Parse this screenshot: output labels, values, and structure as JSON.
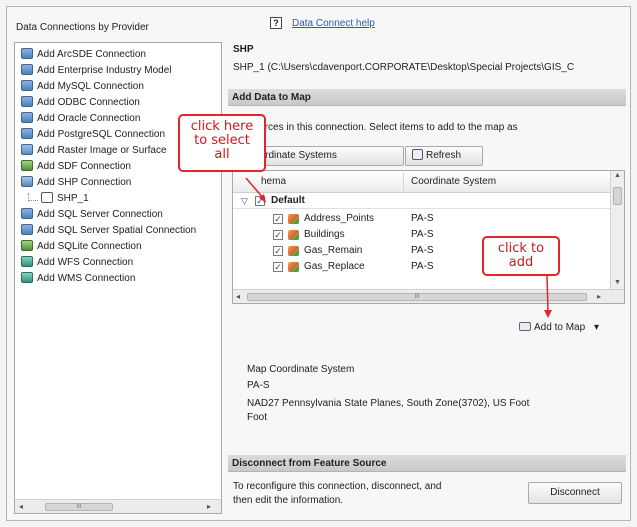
{
  "left_panel": {
    "title": "Data Connections by Provider",
    "items": [
      {
        "label": "Add ArcSDE Connection",
        "icon": "database-icon"
      },
      {
        "label": "Add Enterprise Industry Model",
        "icon": "database-icon"
      },
      {
        "label": "Add MySQL Connection",
        "icon": "database-icon"
      },
      {
        "label": "Add ODBC Connection",
        "icon": "database-icon"
      },
      {
        "label": "Add Oracle Connection",
        "icon": "database-icon"
      },
      {
        "label": "Add PostgreSQL Connection",
        "icon": "database-icon"
      },
      {
        "label": "Add Raster Image or Surface",
        "icon": "raster-icon"
      },
      {
        "label": "Add SDF Connection",
        "icon": "sdf-icon"
      },
      {
        "label": "Add SHP Connection",
        "icon": "shp-icon"
      },
      {
        "label": "SHP_1",
        "icon": "connection-child-icon"
      },
      {
        "label": "Add SQL Server Connection",
        "icon": "database-icon"
      },
      {
        "label": "Add SQL Server Spatial Connection",
        "icon": "database-icon"
      },
      {
        "label": "Add SQLite Connection",
        "icon": "sdf-icon"
      },
      {
        "label": "Add WFS Connection",
        "icon": "wfs-icon"
      },
      {
        "label": "Add WMS Connection",
        "icon": "wfs-icon"
      }
    ],
    "scroll_thumb": "III"
  },
  "header": {
    "help_icon": "?",
    "help_link": "Data Connect help",
    "connection_title": "SHP",
    "connection_path": "SHP_1 (C:\\Users\\cdavenport.CORPORATE\\Desktop\\Special Projects\\GIS_C"
  },
  "add_data": {
    "section_title": "Add Data to Map",
    "info_text": "cle sources in this connection.  Select items to add to the map as",
    "edit_cs_button": "it Coordinate Systems",
    "refresh_button": "Refresh",
    "columns": [
      "hema",
      "Coordinate System"
    ],
    "group_label": "Default",
    "rows": [
      {
        "name": "Address_Points",
        "cs": "PA-S",
        "checked": true
      },
      {
        "name": "Buildings",
        "cs": "PA-S",
        "checked": true
      },
      {
        "name": "Gas_Remain",
        "cs": "PA-S",
        "checked": true
      },
      {
        "name": "Gas_Replace",
        "cs": "PA-S",
        "checked": true
      }
    ],
    "scroll_thumb": "III",
    "add_to_map_button": "Add to Map",
    "dropdown_arrow": "▾"
  },
  "map_cs": {
    "label": "Map Coordinate System",
    "code": "PA-S",
    "description_line1": "NAD27 Pennsylvania State Planes, South Zone(3702), US Foot",
    "description_line2": "Foot"
  },
  "disconnect": {
    "section_title": "Disconnect from Feature Source",
    "text_line1": "To reconfigure this connection, disconnect, and",
    "text_line2": "then edit the information.",
    "button": "Disconnect"
  },
  "callouts": {
    "select_all": [
      "click here",
      "to select",
      "all"
    ],
    "add": [
      "click to",
      "add"
    ]
  },
  "colors": {
    "callout_red": "#e0252b",
    "link_blue": "#2a5db0",
    "section_bar": "#d2d2d2"
  }
}
